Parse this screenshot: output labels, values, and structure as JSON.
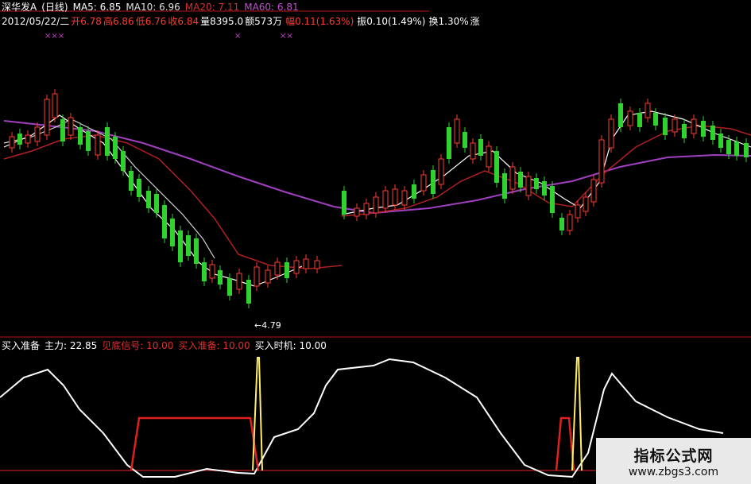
{
  "header": {
    "stock": "深华发A",
    "period": "(日线)",
    "ma5": "MA5: 6.85",
    "ma10": "MA10: 6.96",
    "ma20": "MA20: 7.11",
    "ma60": "MA60: 6.81",
    "date": "2012/05/22/二",
    "open": "开6.78",
    "high": "高6.86",
    "low": "低6.76",
    "close": "收6.84",
    "volume": "量8395.0",
    "amount": "额573万",
    "change": "幅0.11(1.63%)",
    "amplitude": "振0.10(1.49%)",
    "turnover": "换1.30%",
    "truncated": "涨"
  },
  "marks": [
    "×××",
    "×",
    "××"
  ],
  "price_annotation": "←4.79",
  "indicator": {
    "name": "买入准备",
    "main_force": "主力: 22.85",
    "signal": "见底信号: 10.00",
    "prepare": "买入准备: 10.00",
    "timing": "买入时机: 10.00"
  },
  "watermark": {
    "title": "指标公式网",
    "url": "www.zbgs3.com"
  },
  "colors": {
    "up": "#ff3b30",
    "down": "#2fd22f",
    "ma5": "#ffffff",
    "ma10": "#d7d7d7",
    "ma20": "#b02020",
    "ma60": "#a040c0",
    "main": "#ffffff",
    "prepare": "#e02020",
    "timing": "#ffee66",
    "frame": "#a01818"
  }
}
